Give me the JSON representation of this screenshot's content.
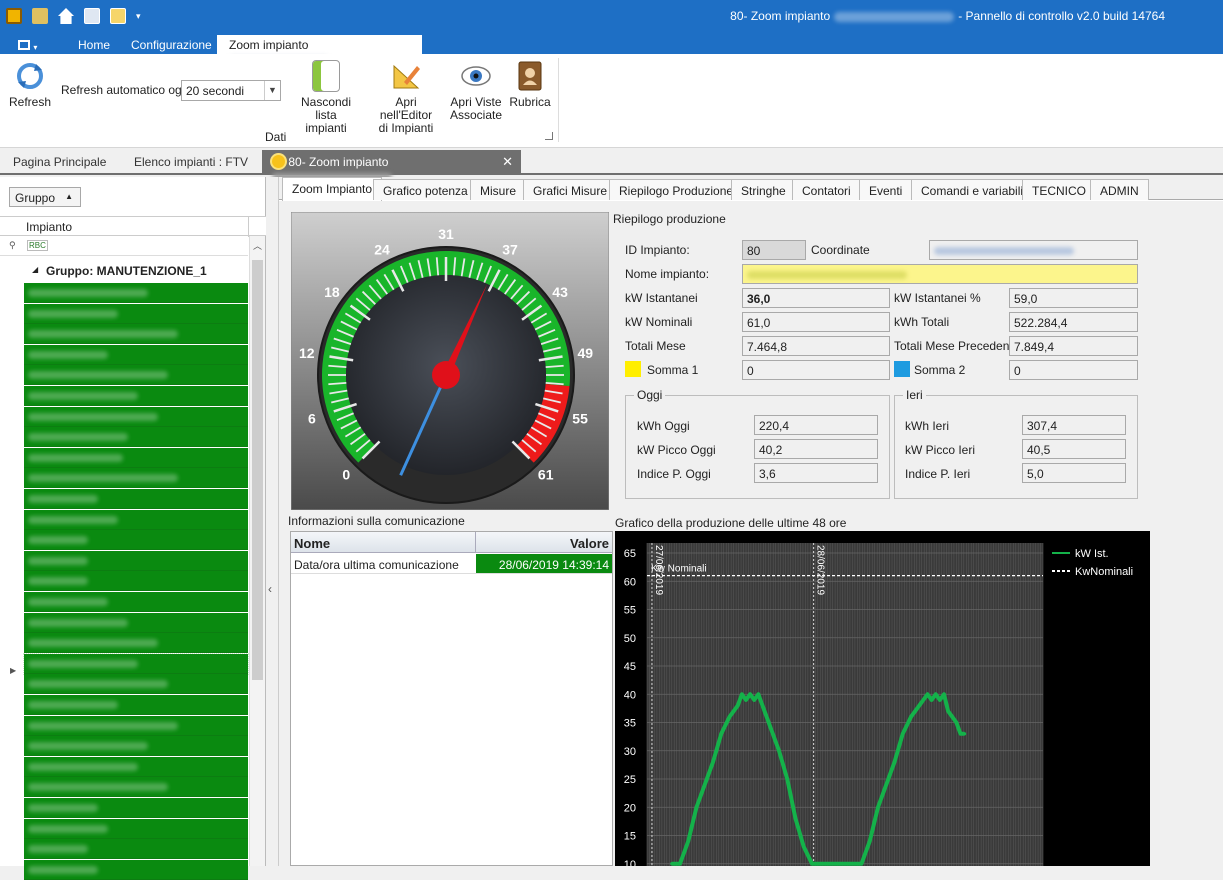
{
  "titlebar": {
    "title_prefix": "80- Zoom impianto",
    "title_suffix": "- Pannello di controllo v2.0 build 14764"
  },
  "ribbon_tabs": [
    "Home",
    "Configurazione",
    "Zoom impianto"
  ],
  "ribbon": {
    "refresh_label": "Refresh",
    "auto_refresh_label": "Refresh automatico ogni",
    "auto_refresh_value": "20 secondi",
    "hide_list_label_1": "Nascondi lista",
    "hide_list_label_2": "impianti",
    "open_editor_label_1": "Apri nell'Editor",
    "open_editor_label_2": "di Impianti",
    "open_views_label_1": "Apri Viste",
    "open_views_label_2": "Associate",
    "rubrica_label": "Rubrica",
    "group_label": "Dati"
  },
  "doc_tabs": {
    "home": "Pagina Principale",
    "list": "Elenco impianti : FTV",
    "zoom": "80- Zoom impianto"
  },
  "left": {
    "group_button": "Gruppo",
    "column_header": "Impianto",
    "filter_text": "RBC",
    "group_row": "Gruppo: MANUTENZIONE_1"
  },
  "panel_tabs": [
    "Zoom Impianto",
    "Grafico potenza",
    "Misure",
    "Grafici Misure",
    "Riepilogo Produzione",
    "Stringhe",
    "Contatori",
    "Eventi",
    "Comandi e variabili",
    "TECNICO",
    "ADMIN"
  ],
  "gauge": {
    "ticks": [
      "0",
      "6",
      "12",
      "18",
      "24",
      "31",
      "37",
      "43",
      "49",
      "55",
      "61"
    ],
    "max": 61,
    "value": 36.0
  },
  "summary": {
    "title": "Riepilogo produzione",
    "id_label": "ID Impianto:",
    "id_value": "80",
    "coord_label": "Coordinate",
    "name_label": "Nome impianto:",
    "kw_ist_label": "kW Istantanei",
    "kw_ist_value": "36,0",
    "kw_ist_pct_label": "kW Istantanei %",
    "kw_ist_pct_value": "59,0",
    "kw_nom_label": "kW Nominali",
    "kw_nom_value": "61,0",
    "kwh_tot_label": "kWh Totali",
    "kwh_tot_value": "522.284,4",
    "month_label": "Totali Mese",
    "month_value": "7.464,8",
    "prev_month_label": "Totali Mese Precedente",
    "prev_month_value": "7.849,4",
    "sum1_label": "Somma 1",
    "sum1_value": "0",
    "sum2_label": "Somma 2",
    "sum2_value": "0",
    "colors": {
      "sum1": "#ffee00",
      "sum2": "#1e9be0"
    }
  },
  "today": {
    "title": "Oggi",
    "kwh_label": "kWh Oggi",
    "kwh_value": "220,4",
    "peak_label": "kW Picco Oggi",
    "peak_value": "40,2",
    "index_label": "Indice  P. Oggi",
    "index_value": "3,6"
  },
  "yesterday": {
    "title": "Ieri",
    "kwh_label": "kWh Ieri",
    "kwh_value": "307,4",
    "peak_label": "kW Picco Ieri",
    "peak_value": "40,5",
    "index_label": "Indice P. Ieri",
    "index_value": "5,0"
  },
  "comm": {
    "title": "Informazioni sulla comunicazione",
    "col_name": "Nome",
    "col_value": "Valore",
    "row_name": "Data/ora ultima comunicazione",
    "row_value": "28/06/2019 14:39:14"
  },
  "chart_data": {
    "type": "line",
    "title": "Grafico della produzione delle ultime 48 ore",
    "yticks": [
      65,
      60,
      55,
      50,
      45,
      40,
      35,
      30,
      25,
      20,
      15,
      10
    ],
    "ylim": [
      10,
      65
    ],
    "date_labels": [
      "27/06/2019",
      "28/06/2019"
    ],
    "nominal_label": "Kw Nominali",
    "nominal_value": 61,
    "legend": [
      "kW Ist.",
      "KwNominali"
    ],
    "series": [
      {
        "name": "kW Ist.",
        "color": "#14b24a",
        "x": [
          3,
          4,
          5,
          6,
          7,
          8,
          9,
          10,
          11,
          11.5,
          12,
          12.5,
          13,
          13.5,
          14,
          14.5,
          15,
          16,
          17,
          18,
          19,
          20,
          24,
          25,
          26,
          27,
          28,
          29,
          30,
          31,
          32,
          33,
          34,
          34.5,
          35,
          35.5,
          36,
          36.5,
          37,
          37.5,
          38,
          38.5
        ],
        "values": [
          10,
          10,
          14,
          20,
          24,
          28,
          33,
          36,
          38,
          40,
          39,
          40,
          39,
          40,
          38,
          36,
          34,
          30,
          25,
          18,
          13,
          10,
          10,
          10,
          10,
          14,
          20,
          24,
          28,
          33,
          36,
          38,
          40,
          39,
          40,
          39,
          40,
          37,
          36,
          35,
          33,
          33
        ]
      }
    ]
  }
}
